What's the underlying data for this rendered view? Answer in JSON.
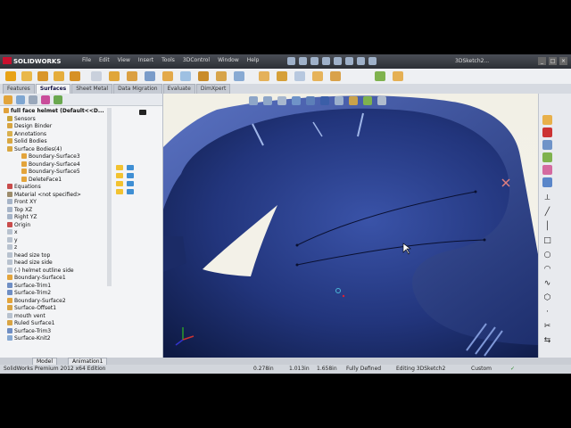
{
  "app": {
    "name": "SOLIDWORKS",
    "menu": [
      "File",
      "Edit",
      "View",
      "Insert",
      "Tools",
      "3DControl",
      "Window",
      "Help"
    ],
    "document_title": "3DSketch2..."
  },
  "tabs": [
    "Features",
    "Surfaces",
    "Sheet Metal",
    "Data Migration",
    "Evaluate",
    "DimXpert"
  ],
  "active_tab": "Surfaces",
  "feature_tree": {
    "root": "full face helmet  (Default<<D...",
    "items": [
      "Sensors",
      "Design Binder",
      "Annotations",
      "Solid Bodies",
      "Surface Bodies(4)",
      "Boundary-Surface3",
      "Boundary-Surface4",
      "Boundary-Surface5",
      "DeleteFace1",
      "Equations",
      "Material <not specified>",
      "Front XY",
      "Top XZ",
      "Right YZ",
      "Origin",
      "x",
      "y",
      "z",
      "head size top",
      "head size side",
      "(-) helmet outline side",
      "Boundary-Surface1",
      "Surface-Trim1",
      "Surface-Trim2",
      "Boundary-Surface2",
      "Surface-Offset1",
      "mouth vent",
      "Ruled Surface1",
      "Surface-Trim3",
      "Surface-Knit2"
    ]
  },
  "bottom_tabs": [
    "Model",
    "Animation1"
  ],
  "status": {
    "edition": "SolidWorks Premium 2012 x64 Edition",
    "x": "0.278in",
    "y": "1.013in",
    "z": "1.658in",
    "state": "Fully Defined",
    "editing": "Editing 3DSketch2",
    "units": "Custom"
  },
  "colors": {
    "surface_dark": "#12204f",
    "surface_light": "#3a53a8",
    "viewport_bg": "#f3f1e8",
    "accent_red": "#c8102e"
  }
}
